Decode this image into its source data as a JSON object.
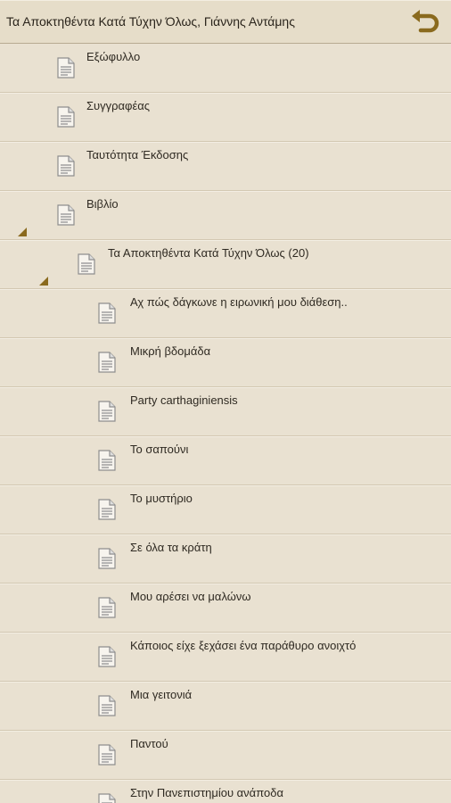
{
  "header": {
    "title": "Τα Αποκτηθέντα Κατά Τύχην Όλως, Γιάννης Αντάμης",
    "back_icon": "undo-arrow-icon",
    "accent": "#8a6a1e"
  },
  "toc": {
    "items": [
      {
        "label": "Εξώφυλλο",
        "level": 0
      },
      {
        "label": "Συγγραφέας",
        "level": 0
      },
      {
        "label": "Ταυτότητα Έκδοσης",
        "level": 0
      },
      {
        "label": "Βιβλίο",
        "level": 0,
        "expanded": true
      },
      {
        "label": "Τα Αποκτηθέντα Κατά Τύχην Όλως (20)",
        "level": 1,
        "expanded": true
      },
      {
        "label": "Αχ πώς δάγκωνε η ειρωνική μου διάθεση..",
        "level": 2
      },
      {
        "label": "Μικρή βδομάδα",
        "level": 2
      },
      {
        "label": "Party carthaginiensis",
        "level": 2
      },
      {
        "label": "Το σαπούνι",
        "level": 2
      },
      {
        "label": "Το μυστήριο",
        "level": 2
      },
      {
        "label": "Σε όλα τα κράτη",
        "level": 2
      },
      {
        "label": "Μου αρέσει να μαλώνω",
        "level": 2
      },
      {
        "label": "Κάποιος είχε ξεχάσει ένα παράθυρο ανοιχτό",
        "level": 2
      },
      {
        "label": "Μια γειτονιά",
        "level": 2
      },
      {
        "label": "Παντού",
        "level": 2
      },
      {
        "label": "Στην Πανεπιστημίου ανάποδα",
        "level": 2
      }
    ]
  }
}
